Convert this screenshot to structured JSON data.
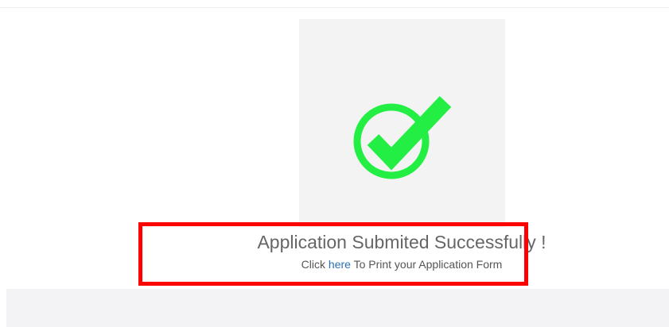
{
  "success": {
    "title": "Application Submited Successfully !",
    "print_prefix": "Click ",
    "print_link": "here",
    "print_suffix": " To Print your Application Form"
  },
  "icons": {
    "status_icon": "check-circle-icon",
    "icon_color": "#22ee44"
  },
  "colors": {
    "card_background": "#f3f3f3",
    "highlight_border": "#ff0000",
    "link": "#2a6fb4"
  }
}
